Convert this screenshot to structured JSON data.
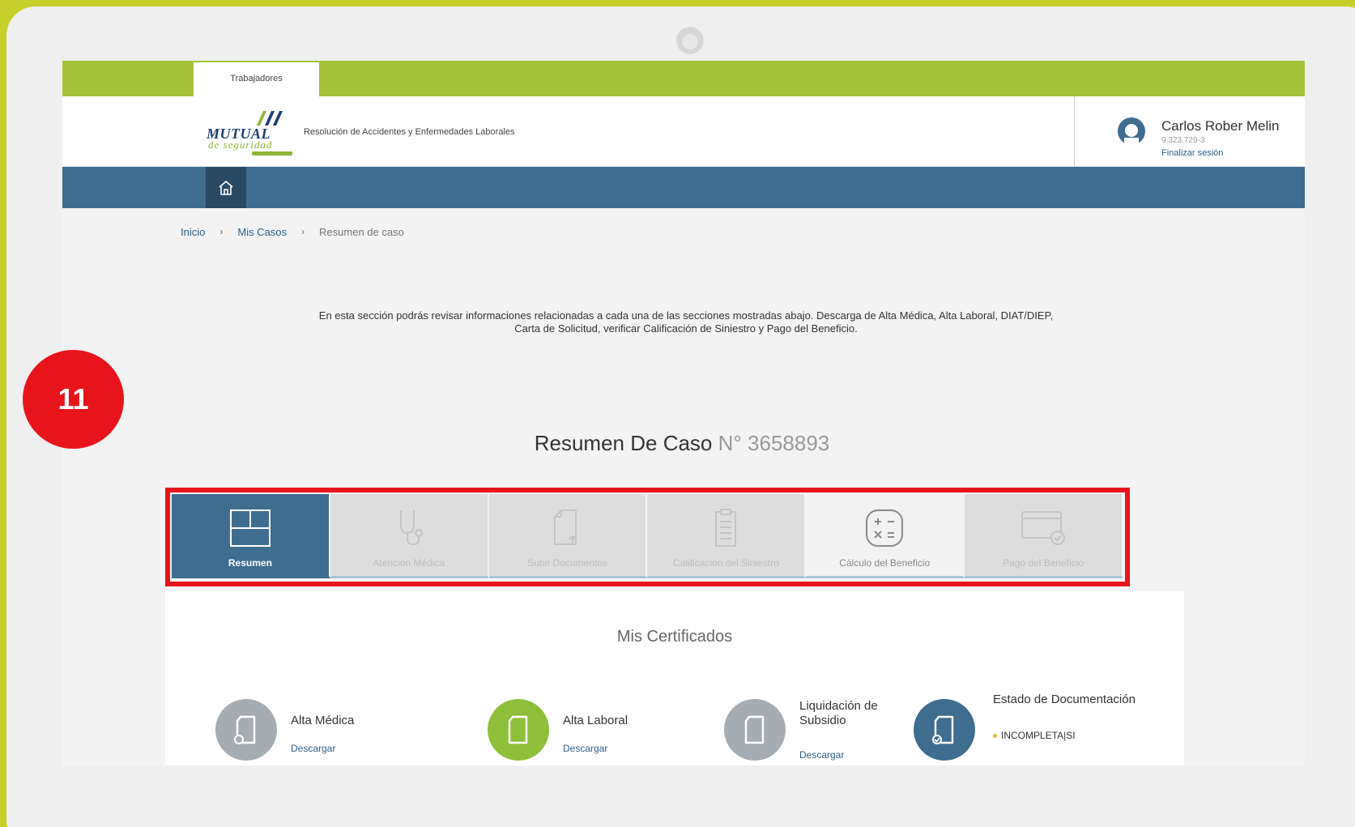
{
  "topbar": {
    "tab_label": "Trabajadores"
  },
  "header": {
    "logo_brand": "MUTUAL",
    "logo_sub": "de seguridad",
    "subtitle": "Resolución de Accidentes y Enfermedades Laborales",
    "user": {
      "name": "Carlos Rober Melin",
      "rut": "9.323.729-3",
      "logout": "Finalizar sesión"
    }
  },
  "breadcrumb": {
    "items": [
      "Inicio",
      "Mis Casos",
      "Resumen de caso"
    ],
    "separator": "›"
  },
  "intro": {
    "line1": "En esta sección podrás revisar informaciones relacionadas a cada una de las secciones mostradas abajo. Descarga de Alta Médica, Alta Laboral, DIAT/DIEP,",
    "line2": "Carta de Solicitud, verificar Calificación de Siniestro y Pago del Beneficio."
  },
  "case": {
    "title": "Resumen De Caso",
    "number": "N° 3658893"
  },
  "tabs": [
    {
      "label": "Resumen",
      "icon": "layout-grid-icon",
      "state": "active"
    },
    {
      "label": "Atención Médica",
      "icon": "stethoscope-icon",
      "state": "disabled"
    },
    {
      "label": "Subir Documentos",
      "icon": "upload-document-icon",
      "state": "disabled"
    },
    {
      "label": "Calificación del Siniestro",
      "icon": "clipboard-icon",
      "state": "disabled"
    },
    {
      "label": "Cálculo del Beneficio",
      "icon": "calculator-icon",
      "state": "enabled"
    },
    {
      "label": "Pago del Beneficio",
      "icon": "card-check-icon",
      "state": "disabled"
    }
  ],
  "step_badge": "11",
  "certificates": {
    "title": "Mis Certificados",
    "items": [
      {
        "name": "Alta Médica",
        "link": "Descargar",
        "color": "#a6adb2",
        "icon": "document-icon"
      },
      {
        "name": "Alta Laboral",
        "link": "Descargar",
        "color": "#8fbf3a",
        "icon": "document-icon"
      },
      {
        "name": "Liquidación de Subsidio",
        "link": "Descargar",
        "color": "#a6adb2",
        "icon": "document-icon"
      },
      {
        "name": "Estado de Documentación",
        "status": "INCOMPLETA|SI",
        "color": "#3f6d8f",
        "icon": "document-check-icon"
      }
    ]
  },
  "colors": {
    "accent_green": "#a5c33a",
    "nav_blue": "#3f6d8f",
    "highlight_red": "#e8141c",
    "frame_green": "#c6d02a"
  }
}
